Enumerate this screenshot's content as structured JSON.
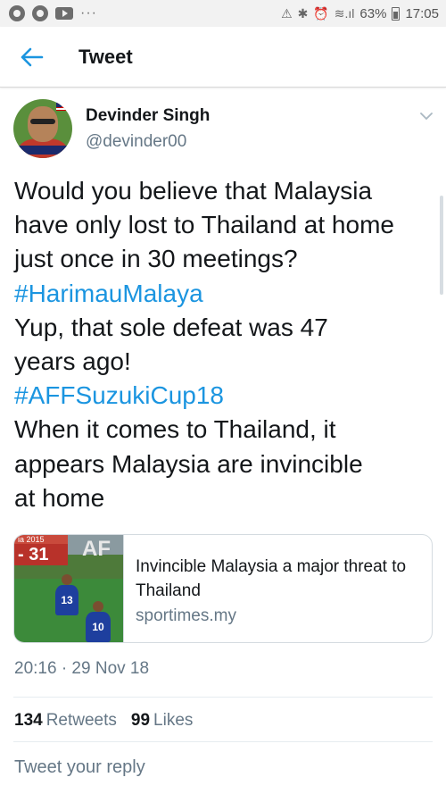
{
  "status_bar": {
    "left_icons": [
      "g-app-icon",
      "g-app-icon",
      "youtube-icon"
    ],
    "more": "···",
    "battery_percent": "63%",
    "time": "17:05"
  },
  "header": {
    "back_icon": "arrow-left-icon",
    "title": "Tweet"
  },
  "tweet": {
    "author_name": "Devinder Singh",
    "author_handle": "@devinder00",
    "lines": [
      {
        "text": "Would you believe that Malaysia",
        "hashtag": false
      },
      {
        "text": "have only lost to Thailand at home",
        "hashtag": false
      },
      {
        "text": "just once in 30 meetings?",
        "hashtag": false
      },
      {
        "text": "#HarimauMalaya",
        "hashtag": true
      },
      {
        "text": "Yup, that sole defeat was 47",
        "hashtag": false
      },
      {
        "text": "years ago!",
        "hashtag": false
      },
      {
        "text": "#AFFSuzukiCup18",
        "hashtag": true
      },
      {
        "text": "When it comes to Thailand, it",
        "hashtag": false
      },
      {
        "text": "appears Malaysia are invincible",
        "hashtag": false
      },
      {
        "text": "at home",
        "hashtag": false
      }
    ],
    "card": {
      "thumb_top": "ia 2015",
      "thumb_score": "- 31",
      "thumb_logo": "AF",
      "player1_number": "13",
      "player2_number": "10",
      "title": "Invincible Malaysia a major threat to Thailand",
      "domain": "sportimes.my"
    },
    "timestamp": "20:16 · 29 Nov 18",
    "retweets_count": "134",
    "retweets_label": "Retweets",
    "likes_count": "99",
    "likes_label": "Likes"
  },
  "reply": {
    "placeholder": "Tweet your reply"
  },
  "colors": {
    "link": "#1b95e0",
    "secondary_text": "#657786",
    "primary_text": "#14171a"
  }
}
